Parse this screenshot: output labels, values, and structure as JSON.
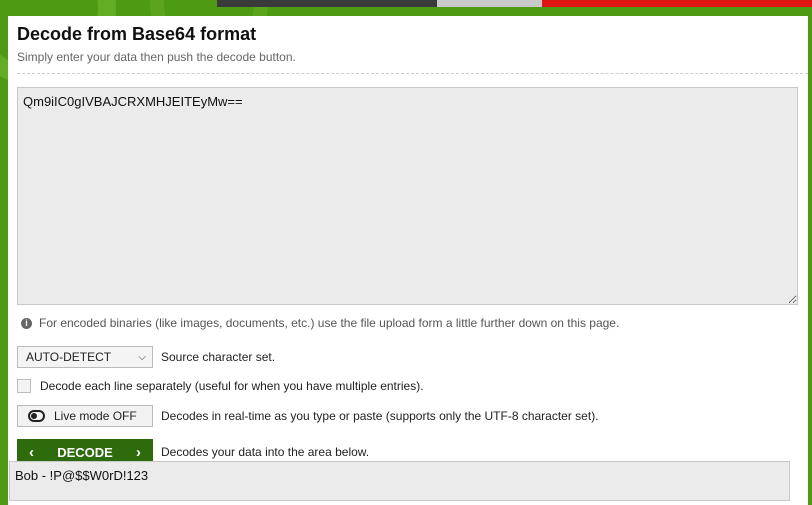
{
  "page": {
    "title": "Decode from Base64 format",
    "subtitle": "Simply enter your data then push the decode button."
  },
  "input": {
    "value": "Qm9iIC0gIVBAJCRXMHJEITEyMw=="
  },
  "info": {
    "text": "For encoded binaries (like images, documents, etc.) use the file upload form a little further down on this page."
  },
  "charset": {
    "selected": "AUTO-DETECT",
    "label": "Source character set."
  },
  "line_option": {
    "label": "Decode each line separately (useful for when you have multiple entries)."
  },
  "live_mode": {
    "button_label": "Live mode OFF",
    "description": "Decodes in real-time as you type or paste (supports only the UTF-8 character set)."
  },
  "decode": {
    "button_label": "DECODE",
    "description": "Decodes your data into the area below."
  },
  "output": {
    "value": "Bob - !P@$$W0rD!123"
  },
  "colors": {
    "background": "#4e9a12",
    "decode_button": "#2e6b0d",
    "banner": "#e01616"
  }
}
